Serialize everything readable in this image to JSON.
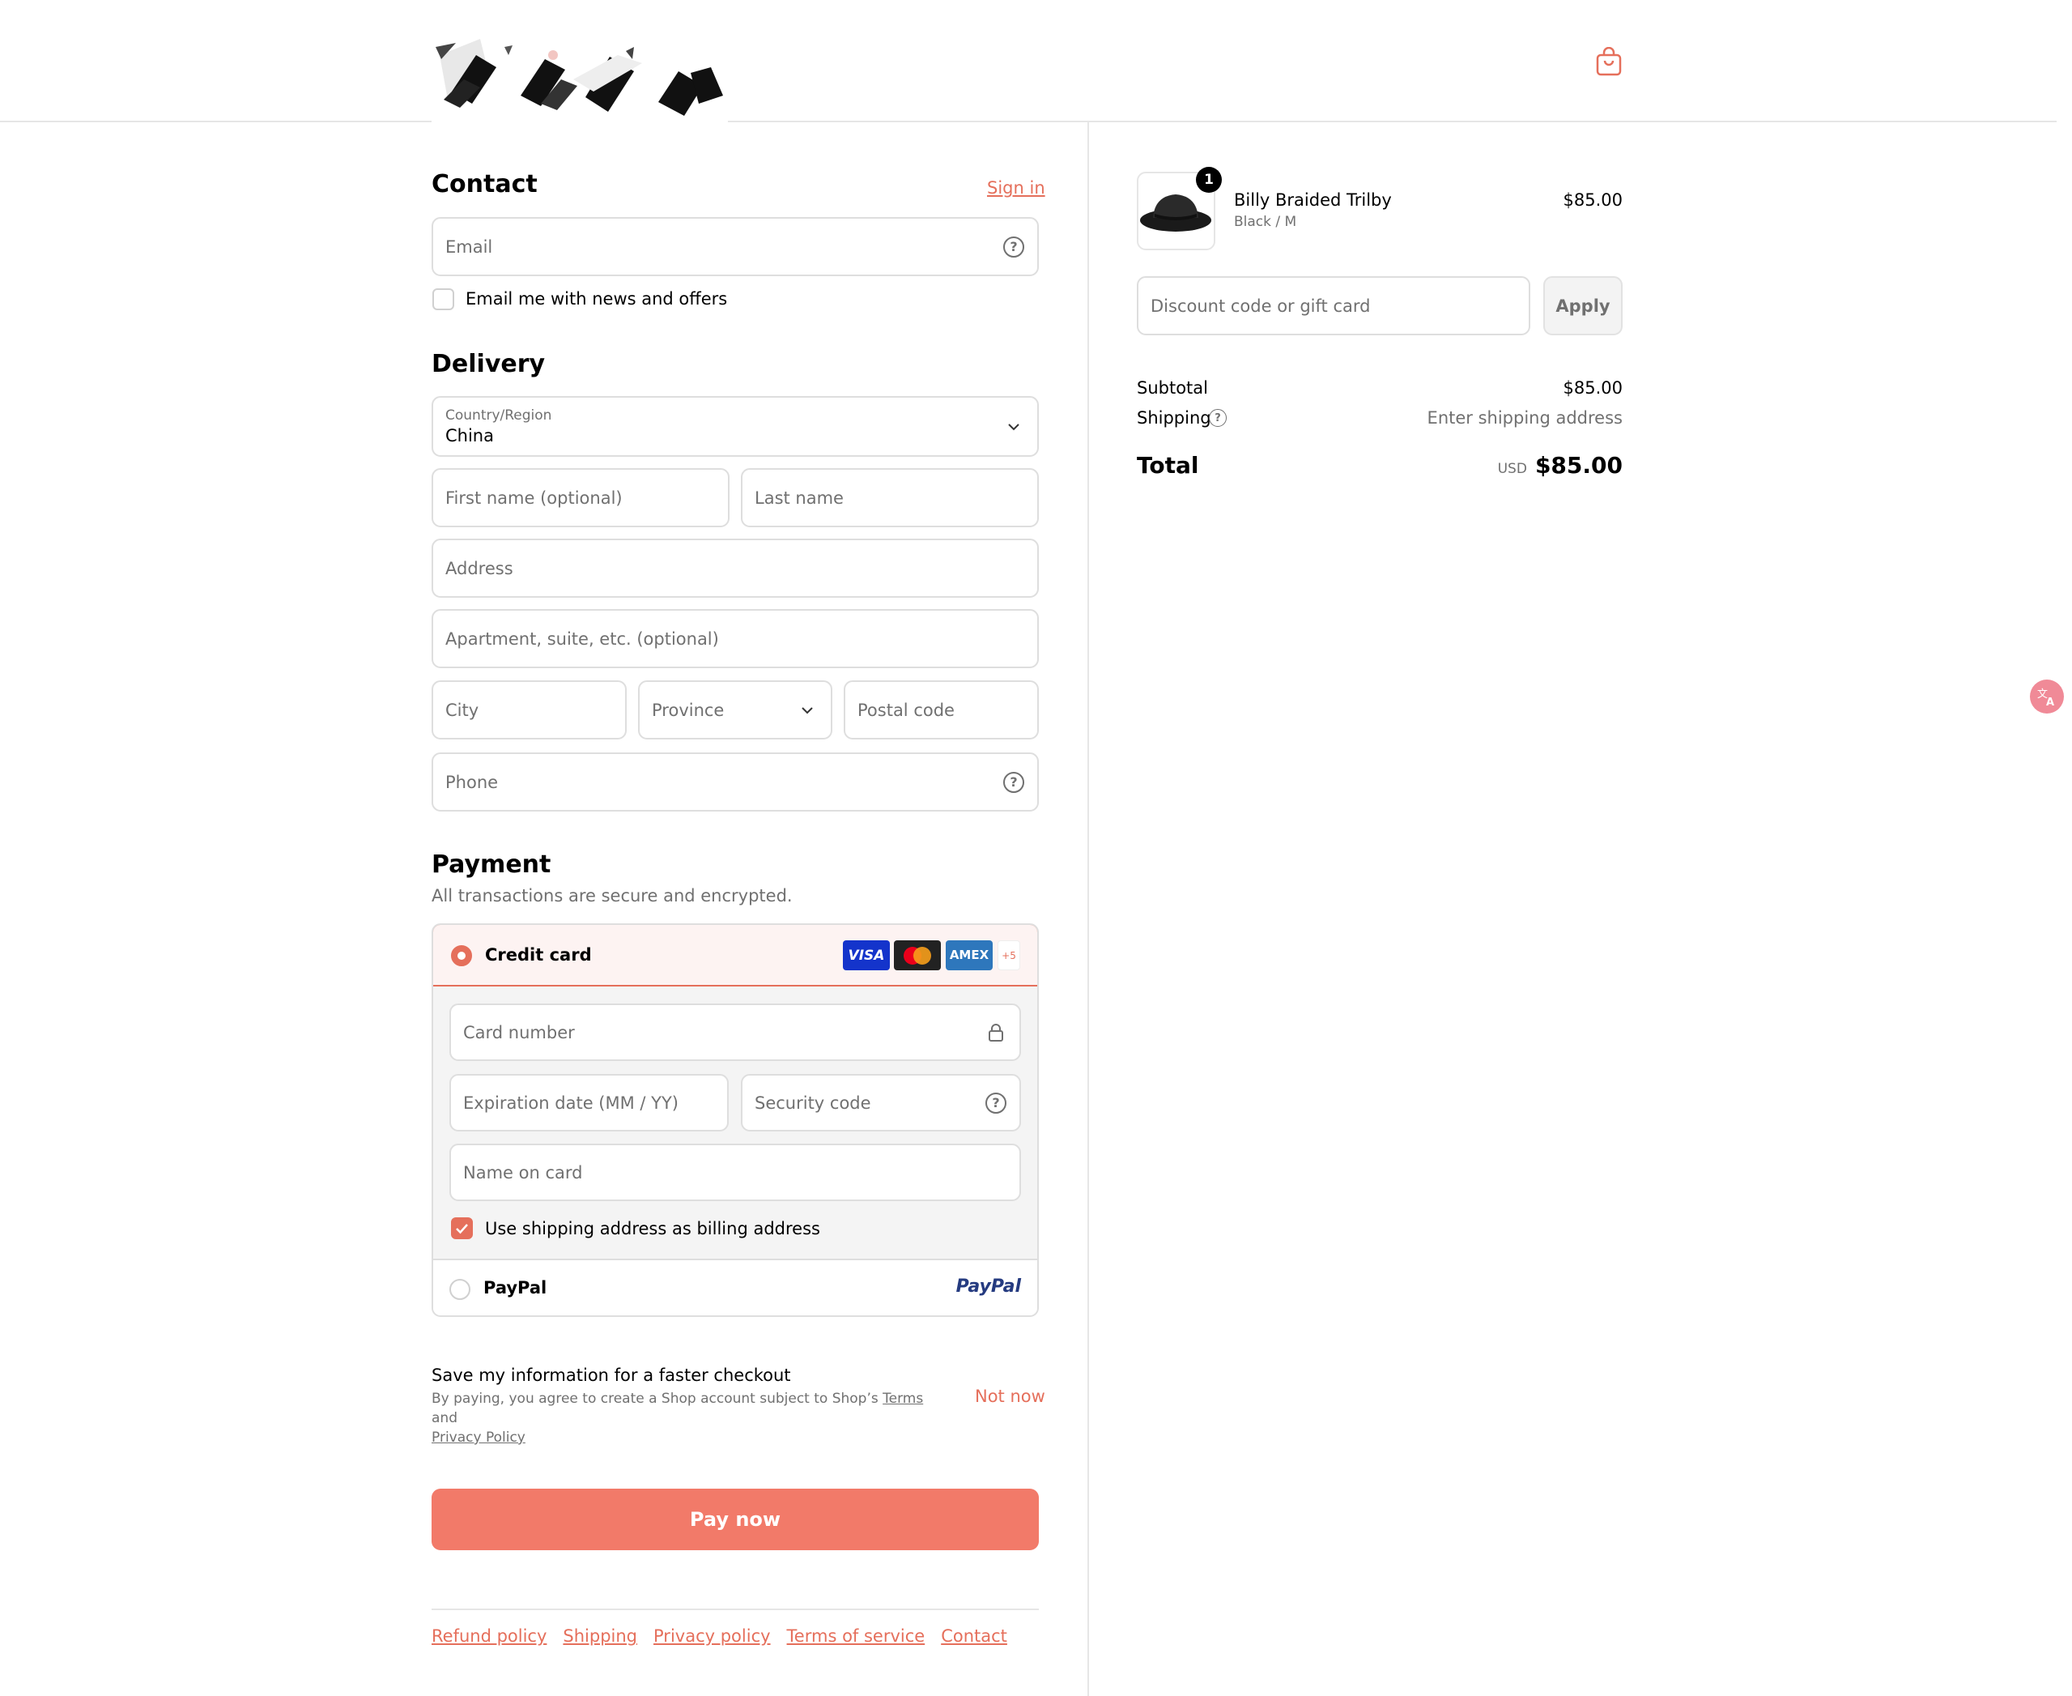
{
  "header": {
    "logo_icon": "brand-logo",
    "cart_icon": "shopping-bag-icon"
  },
  "contact": {
    "title": "Contact",
    "sign_in": "Sign in",
    "email_placeholder": "Email",
    "email_news_label": "Email me with news and offers",
    "email_news_checked": false
  },
  "delivery": {
    "title": "Delivery",
    "country_label": "Country/Region",
    "country_value": "China",
    "first_name_placeholder": "First name (optional)",
    "last_name_placeholder": "Last name",
    "address_placeholder": "Address",
    "apartment_placeholder": "Apartment, suite, etc. (optional)",
    "city_placeholder": "City",
    "province_placeholder": "Province",
    "postal_placeholder": "Postal code",
    "phone_placeholder": "Phone"
  },
  "payment": {
    "title": "Payment",
    "subtitle": "All transactions are secure and encrypted.",
    "credit_card_label": "Credit card",
    "card_brands": [
      "VISA",
      "Mastercard",
      "AMEX"
    ],
    "more_brands": "+5",
    "card_number_placeholder": "Card number",
    "expiration_placeholder": "Expiration date (MM / YY)",
    "security_placeholder": "Security code",
    "name_on_card_placeholder": "Name on card",
    "billing_same_label": "Use shipping address as billing address",
    "billing_same_checked": true,
    "paypal_label": "PayPal",
    "paypal_logo": "PayPal",
    "selected_method": "credit-card"
  },
  "save_info": {
    "title": "Save my information for a faster checkout",
    "text_prefix": "By paying, you agree to create a Shop account subject to Shop’s ",
    "terms": "Terms",
    "and": " and",
    "privacy": "Privacy Policy",
    "not_now": "Not now"
  },
  "pay_now": "Pay now",
  "footer": {
    "links": [
      "Refund policy",
      "Shipping",
      "Privacy policy",
      "Terms of service",
      "Contact"
    ]
  },
  "summary": {
    "item": {
      "quantity": "1",
      "name": "Billy Braided Trilby",
      "variant": "Black / M",
      "price": "$85.00"
    },
    "discount_placeholder": "Discount code or gift card",
    "apply": "Apply",
    "subtotal_label": "Subtotal",
    "subtotal_value": "$85.00",
    "shipping_label": "Shipping",
    "shipping_value": "Enter shipping address",
    "total_label": "Total",
    "currency": "USD",
    "total_value": "$85.00"
  },
  "colors": {
    "accent": "#e56f5b",
    "button": "#f27a69"
  }
}
